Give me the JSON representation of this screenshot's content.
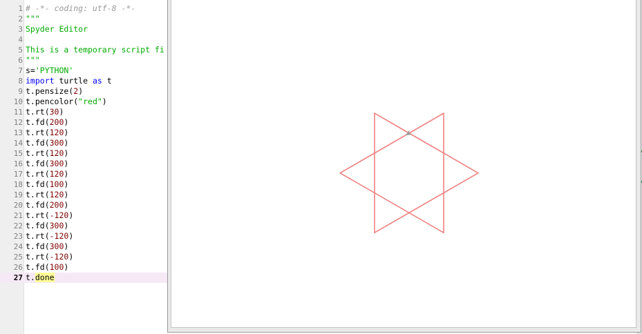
{
  "editor": {
    "lines": [
      {
        "num": "1",
        "parts": [
          {
            "t": "# -*- coding: utf-8 -*-",
            "c": "comment"
          }
        ]
      },
      {
        "num": "2",
        "parts": [
          {
            "t": "\"\"\"",
            "c": "string"
          }
        ]
      },
      {
        "num": "3",
        "parts": [
          {
            "t": "Spyder Editor",
            "c": "string"
          }
        ]
      },
      {
        "num": "4",
        "parts": []
      },
      {
        "num": "5",
        "parts": [
          {
            "t": "This is a temporary script fi",
            "c": "string"
          }
        ]
      },
      {
        "num": "6",
        "parts": [
          {
            "t": "\"\"\"",
            "c": "string"
          }
        ]
      },
      {
        "num": "7",
        "parts": [
          {
            "t": "s=",
            "c": ""
          },
          {
            "t": "'PYTHON'",
            "c": "string"
          }
        ]
      },
      {
        "num": "8",
        "parts": [
          {
            "t": "import",
            "c": "keyword"
          },
          {
            "t": " turtle ",
            "c": ""
          },
          {
            "t": "as",
            "c": "keyword"
          },
          {
            "t": " t",
            "c": ""
          }
        ]
      },
      {
        "num": "9",
        "parts": [
          {
            "t": "t.pensize(",
            "c": ""
          },
          {
            "t": "2",
            "c": "num"
          },
          {
            "t": ")",
            "c": ""
          }
        ]
      },
      {
        "num": "10",
        "parts": [
          {
            "t": "t.pencolor(",
            "c": ""
          },
          {
            "t": "\"red\"",
            "c": "string"
          },
          {
            "t": ")",
            "c": ""
          }
        ]
      },
      {
        "num": "11",
        "parts": [
          {
            "t": "t.rt(",
            "c": ""
          },
          {
            "t": "30",
            "c": "num"
          },
          {
            "t": ")",
            "c": ""
          }
        ]
      },
      {
        "num": "12",
        "parts": [
          {
            "t": "t.fd(",
            "c": ""
          },
          {
            "t": "200",
            "c": "num"
          },
          {
            "t": ")",
            "c": ""
          }
        ]
      },
      {
        "num": "13",
        "parts": [
          {
            "t": "t.rt(",
            "c": ""
          },
          {
            "t": "120",
            "c": "num"
          },
          {
            "t": ")",
            "c": ""
          }
        ]
      },
      {
        "num": "14",
        "parts": [
          {
            "t": "t.fd(",
            "c": ""
          },
          {
            "t": "300",
            "c": "num"
          },
          {
            "t": ")",
            "c": ""
          }
        ]
      },
      {
        "num": "15",
        "parts": [
          {
            "t": "t.rt(",
            "c": ""
          },
          {
            "t": "120",
            "c": "num"
          },
          {
            "t": ")",
            "c": ""
          }
        ]
      },
      {
        "num": "16",
        "parts": [
          {
            "t": "t.fd(",
            "c": ""
          },
          {
            "t": "300",
            "c": "num"
          },
          {
            "t": ")",
            "c": ""
          }
        ]
      },
      {
        "num": "17",
        "parts": [
          {
            "t": "t.rt(",
            "c": ""
          },
          {
            "t": "120",
            "c": "num"
          },
          {
            "t": ")",
            "c": ""
          }
        ]
      },
      {
        "num": "18",
        "parts": [
          {
            "t": "t.fd(",
            "c": ""
          },
          {
            "t": "100",
            "c": "num"
          },
          {
            "t": ")",
            "c": ""
          }
        ]
      },
      {
        "num": "19",
        "parts": [
          {
            "t": "t.rt(",
            "c": ""
          },
          {
            "t": "120",
            "c": "num"
          },
          {
            "t": ")",
            "c": ""
          }
        ]
      },
      {
        "num": "20",
        "parts": [
          {
            "t": "t.fd(",
            "c": ""
          },
          {
            "t": "200",
            "c": "num"
          },
          {
            "t": ")",
            "c": ""
          }
        ]
      },
      {
        "num": "21",
        "parts": [
          {
            "t": "t.rt(",
            "c": ""
          },
          {
            "t": "-120",
            "c": "num"
          },
          {
            "t": ")",
            "c": ""
          }
        ]
      },
      {
        "num": "22",
        "parts": [
          {
            "t": "t.fd(",
            "c": ""
          },
          {
            "t": "300",
            "c": "num"
          },
          {
            "t": ")",
            "c": ""
          }
        ]
      },
      {
        "num": "23",
        "parts": [
          {
            "t": "t.rt(",
            "c": ""
          },
          {
            "t": "-120",
            "c": "num"
          },
          {
            "t": ")",
            "c": ""
          }
        ]
      },
      {
        "num": "24",
        "parts": [
          {
            "t": "t.fd(",
            "c": ""
          },
          {
            "t": "300",
            "c": "num"
          },
          {
            "t": ")",
            "c": ""
          }
        ]
      },
      {
        "num": "25",
        "parts": [
          {
            "t": "t.rt(",
            "c": ""
          },
          {
            "t": "-120",
            "c": "num"
          },
          {
            "t": ")",
            "c": ""
          }
        ]
      },
      {
        "num": "26",
        "parts": [
          {
            "t": "t.fd(",
            "c": ""
          },
          {
            "t": "100",
            "c": "num"
          },
          {
            "t": ")",
            "c": ""
          }
        ]
      },
      {
        "num": "27",
        "current": true,
        "parts": [
          {
            "t": "t.",
            "c": ""
          },
          {
            "t": "done",
            "c": "hl"
          }
        ]
      }
    ]
  },
  "turtle": {
    "pen_color": "#f08080",
    "commands": [
      [
        "rt",
        30
      ],
      [
        "fd",
        200
      ],
      [
        "rt",
        120
      ],
      [
        "fd",
        300
      ],
      [
        "rt",
        120
      ],
      [
        "fd",
        300
      ],
      [
        "rt",
        120
      ],
      [
        "fd",
        100
      ],
      [
        "rt",
        120
      ],
      [
        "fd",
        200
      ],
      [
        "rt",
        -120
      ],
      [
        "fd",
        300
      ],
      [
        "rt",
        -120
      ],
      [
        "fd",
        300
      ],
      [
        "rt",
        -120
      ],
      [
        "fd",
        100
      ]
    ]
  },
  "colors": {
    "comment": "#999999",
    "string": "#00aa00",
    "keyword": "#0000ff",
    "number": "#800000",
    "current_line": "#f6e9f6",
    "turtle_cursor": "#9a9a9a"
  }
}
